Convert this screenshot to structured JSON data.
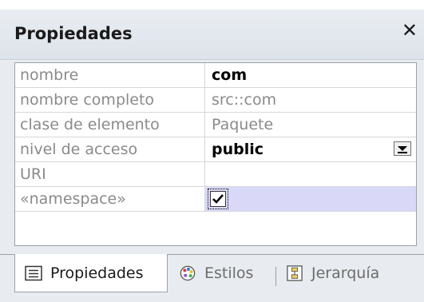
{
  "panel": {
    "title": "Propiedades",
    "close_glyph": "✕"
  },
  "properties": [
    {
      "name": "nombre",
      "value": "com",
      "style": "bold"
    },
    {
      "name": "nombre completo",
      "value": "src::com",
      "style": "gray"
    },
    {
      "name": "clase de elemento",
      "value": "Paquete",
      "style": "gray"
    },
    {
      "name": "nivel de acceso",
      "value": "public",
      "style": "bold",
      "control": "dropdown"
    },
    {
      "name": "URI",
      "value": "",
      "style": "gray"
    },
    {
      "name": "«namespace»",
      "value": "",
      "control": "checkbox",
      "checked": true,
      "selected": true
    }
  ],
  "tabs": [
    {
      "label": "Propiedades",
      "icon": "properties-list-icon",
      "active": true
    },
    {
      "label": "Estilos",
      "icon": "palette-icon",
      "active": false
    },
    {
      "label": "Jerarquía",
      "icon": "hierarchy-icon",
      "active": false
    }
  ],
  "colors": {
    "selected_row": "#d9d9f7",
    "grid_border": "#9aa1ab",
    "panel_bg": "#e8ebef"
  }
}
